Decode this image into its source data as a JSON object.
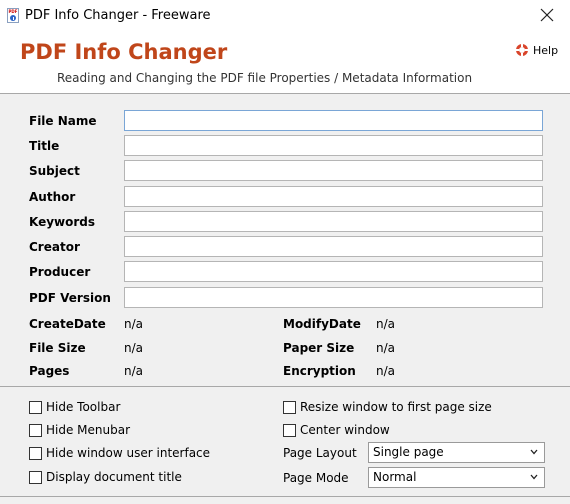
{
  "window": {
    "title": "PDF Info Changer - Freeware",
    "close_glyph": "✕"
  },
  "header": {
    "app_title": "PDF Info Changer",
    "subtitle": "Reading and Changing the PDF file Properties / Metadata Information",
    "help_label": "Help"
  },
  "fields": [
    {
      "label": "File Name",
      "value": ""
    },
    {
      "label": "Title",
      "value": ""
    },
    {
      "label": "Subject",
      "value": ""
    },
    {
      "label": "Author",
      "value": ""
    },
    {
      "label": "Keywords",
      "value": ""
    },
    {
      "label": "Creator",
      "value": ""
    },
    {
      "label": "Producer",
      "value": ""
    },
    {
      "label": "PDF Version",
      "value": ""
    }
  ],
  "info": {
    "create_date": {
      "label": "CreateDate",
      "value": "n/a"
    },
    "modify_date": {
      "label": "ModifyDate",
      "value": "n/a"
    },
    "file_size": {
      "label": "File Size",
      "value": "n/a"
    },
    "paper_size": {
      "label": "Paper Size",
      "value": "n/a"
    },
    "pages": {
      "label": "Pages",
      "value": "n/a"
    },
    "encryption": {
      "label": "Encryption",
      "value": "n/a"
    }
  },
  "options": {
    "hide_toolbar": "Hide Toolbar",
    "hide_menubar": "Hide Menubar",
    "hide_window_ui": "Hide window user interface",
    "display_doc_title": "Display document title",
    "resize_window": "Resize window to first page size",
    "center_window": "Center window",
    "page_layout_label": "Page Layout",
    "page_layout_value": "Single page",
    "page_mode_label": "Page Mode",
    "page_mode_value": "Normal"
  },
  "icons": {
    "app": "pdf-info-app-icon",
    "help": "lifebuoy-icon",
    "dropdown": "chevron-down-icon"
  },
  "colors": {
    "heading": "#c0461a",
    "focus_border": "#7aa6d6"
  }
}
